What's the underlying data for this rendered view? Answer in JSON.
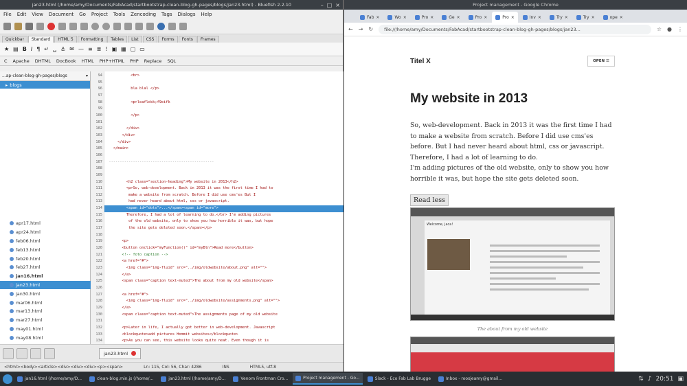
{
  "bluefish": {
    "title": "jan23.html (/home/amy/Documents/FabAcad/startbootstrap-clean-blog-gh-pages/blogs/jan23.html) - Bluefish 2.2.10",
    "menu": [
      "File",
      "Edit",
      "View",
      "Document",
      "Go",
      "Project",
      "Tools",
      "Zencoding",
      "Tags",
      "Dialogs",
      "Help"
    ],
    "tabs": [
      "Quickbar",
      "Standard",
      "HTML 5",
      "Formatting",
      "Tables",
      "List",
      "CSS",
      "Forms",
      "Fonts",
      "Frames"
    ],
    "active_tab": "Standard",
    "sub_toolbar": [
      "C",
      "Apache",
      "DHTML",
      "DocBook",
      "HTML",
      "PHP+HTML",
      "PHP",
      "Replace",
      "SQL"
    ],
    "side_path": "...ap-clean-blog-gh-pages/blogs",
    "side_folder": "blogs",
    "files": [
      {
        "name": "apr17.html"
      },
      {
        "name": "apr24.html"
      },
      {
        "name": "feb06.html"
      },
      {
        "name": "feb13.html"
      },
      {
        "name": "feb20.html"
      },
      {
        "name": "feb27.html"
      },
      {
        "name": "jan16.html",
        "bold": true
      },
      {
        "name": "jan23.html",
        "selected": true
      },
      {
        "name": "jan30.html"
      },
      {
        "name": "mar06.html"
      },
      {
        "name": "mar13.html"
      },
      {
        "name": "mar27.html"
      },
      {
        "name": "may01.html"
      },
      {
        "name": "may08.html"
      }
    ],
    "doc_tab": "jan23.html",
    "status": {
      "path": "<html><body><article><div><div><div><p><span>",
      "position": "Ln: 115, Col: 56, Char: 4286",
      "mode": "INS",
      "encoding": "HTML5, utf-8"
    },
    "line_numbers": [
      "94",
      "95",
      "96",
      "97",
      "98",
      "99",
      "100",
      "101",
      "102",
      "103",
      "104",
      "105",
      "106",
      "107",
      "108",
      "109",
      "110",
      "111",
      "112",
      "113",
      "114",
      "115",
      "116",
      "117",
      "118",
      "119",
      "120",
      "121",
      "122",
      "123",
      "124",
      "125",
      "126",
      "127",
      "128",
      "129",
      "130",
      "131",
      "132",
      "133",
      "134",
      "135",
      "136",
      "137"
    ],
    "code": [
      "            <br>",
      "",
      "            bla blal </p>",
      "",
      "            <p>leafldsk;f9eifk",
      "",
      "            </p>",
      "",
      "          </div>",
      "        </div>",
      "      </div>",
      "    </main>",
      "",
      "  ------------------------------------------------",
      "",
      "",
      "          <h2 class=\"section-heading\">My website in 2013</h2>",
      "          <p>So, web-development. Back in 2013 it was the first time I had to",
      "           make a website from scratch. Before I did use cms'es But I",
      "           had never heard about html, css or javascript.",
      "          <span id=\"dots\">...</span><span id=\"more\">",
      "          Therefore, I had a lot of learning to do.</br> I'm adding pictures",
      "           of the old website, only to show you how horrible it was, but hope",
      "           the site gets deleted soon.</span></p>",
      "",
      "        <p>",
      "        <button onclick=\"myFunction()\" id=\"myBtn\">Read more</button>",
      "        <!-- foto caption -->",
      "        <a href=\"#\">",
      "          <img class=\"img-fluid\" src=\"../img/oldwebsite/about.png\" alt=\"\">",
      "        </a>",
      "        <span class=\"caption text-muted\">The about from my old website</span>",
      "",
      "        <a href=\"#\">",
      "          <img class=\"img-fluid\" src=\"../img/oldwebsite/assignments.png\" alt=\"\">",
      "        </a>",
      "        <span class=\"caption text-muted\">The assignments page of my old website",
      "",
      "        <p>Later in life, I actually got better in web-development. Javascript",
      "        <blockquote>add pictures Hommit websites</blockquote>",
      "        <p>As you can see, this website looks quite neat. Even though it is",
      "        things to do. </p>",
      "",
      ""
    ]
  },
  "chrome": {
    "title": "Project management - Google Chrome",
    "tabs": [
      "Fab",
      "Wo",
      "Pro",
      "Ge",
      "Pro",
      "Pro",
      "Inv",
      "Try",
      "Try",
      "ope"
    ],
    "active_tab_index": 5,
    "url": "file:///home/amy/Documents/FabAcad/startbootstrap-clean-blog-gh-pages/blogs/jan23...",
    "page": {
      "brand": "Titel X",
      "menu_button": "OPEN ☰",
      "heading": "My website in 2013",
      "paragraph": "So, web-development. Back in 2013 it was the first time I had to make a website from scratch. Before I did use cms'es before. But I had never heard about html, css or javascript. Therefore, I had a lot of learning to do.",
      "paragraph2": "I'm adding pictures of the old website, only to show you how horrible it was, but hope the site gets deleted soon.",
      "read_button": "Read less",
      "caption": "The about from my old website",
      "shot_title": "Welcome, jaca!"
    }
  },
  "taskbar": {
    "items": [
      {
        "label": "jan16.html (/home/amy/D..."
      },
      {
        "label": "clean-blog.min.js (/home/..."
      },
      {
        "label": "jan23.html (/home/amy/D..."
      },
      {
        "label": "Venom Frontman Cro..."
      },
      {
        "label": "Project management - Go...",
        "active": true
      },
      {
        "label": "Slack - Eco Fab Lab Brugge"
      },
      {
        "label": "Inbox - roosjeamy@gmail..."
      }
    ],
    "clock": "20:51"
  }
}
